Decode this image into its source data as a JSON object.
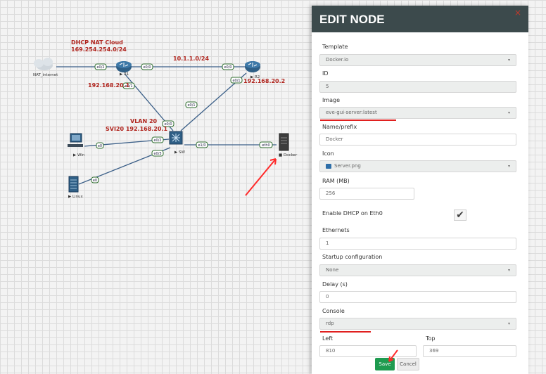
{
  "topology": {
    "labels": {
      "dhcp_nat_cloud": "DHCP NAT Cloud",
      "dhcp_subnet": "169.254.254.0/24",
      "link_subnet": "10.1.1.0/24",
      "r1_ip": "192.168.20.1",
      "r2_ip": "192.168.20.2",
      "vlan": "VLAN 20",
      "svi": "SVI20 192.168.20.1"
    },
    "nodes": {
      "nat": "NAT_internet",
      "r1": "▶ R1",
      "r2": "▶ R2",
      "sw": "▶ SW",
      "win": "▶ Win",
      "linux": "▶ Linux",
      "docker": "■ Docker"
    },
    "interfaces": {
      "r1_e00": "e0/0",
      "r1_e01": "e0/1",
      "r1_e02": "e0/2",
      "r2_e00": "e0/0",
      "r2_e01": "e0/1",
      "sw_e00": "e0/0",
      "sw_e01": "e0/1",
      "sw_e02": "e0/2",
      "sw_e03": "e0/3",
      "sw_e10": "e1/0",
      "win_e0": "e0",
      "linux_e0": "e0",
      "docker_eth0": "eth0"
    }
  },
  "panel": {
    "title": "EDIT NODE",
    "close": "×",
    "fields": {
      "template_label": "Template",
      "template_value": "Docker.io",
      "id_label": "ID",
      "id_value": "5",
      "image_label": "Image",
      "image_value": "eve-gui-server:latest",
      "name_label": "Name/prefix",
      "name_value": "Docker",
      "icon_label": "Icon",
      "icon_value": "Server.png",
      "ram_label": "RAM (MB)",
      "ram_value": "256",
      "dhcp_label": "Enable DHCP on Eth0",
      "dhcp_checked": "✔",
      "ethernets_label": "Ethernets",
      "ethernets_value": "1",
      "startup_label": "Startup configuration",
      "startup_value": "None",
      "delay_label": "Delay (s)",
      "delay_value": "0",
      "console_label": "Console",
      "console_value": "rdp",
      "left_label": "Left",
      "left_value": "810",
      "top_label": "Top",
      "top_value": "369"
    },
    "caret": "▾",
    "save_label": "Save",
    "cancel_label": "Cancel"
  },
  "colors": {
    "header_bg": "#3c4a4c",
    "save_green": "#1e9b4f",
    "annotation_red": "#e0201f",
    "label_red": "#b0241d"
  },
  "icons": {
    "cloud": "cloud-icon",
    "router": "router-icon",
    "switch": "switch-icon",
    "pc": "pc-icon",
    "server": "server-icon",
    "check": "checkmark-icon"
  }
}
